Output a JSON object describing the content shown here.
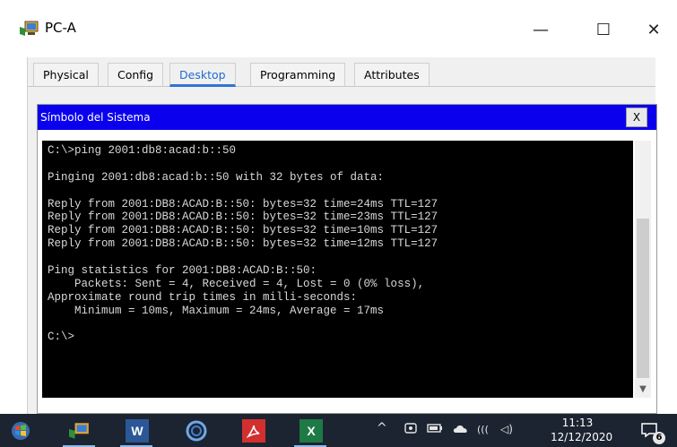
{
  "window": {
    "title": "PC-A",
    "icon": "packet-tracer-pc-icon",
    "controls": {
      "minimize": "—",
      "maximize": "☐",
      "close": "✕"
    }
  },
  "tabs": [
    {
      "label": "Physical",
      "active": false
    },
    {
      "label": "Config",
      "active": false
    },
    {
      "label": "Desktop",
      "active": true
    },
    {
      "label": "Programming",
      "active": false
    },
    {
      "label": "Attributes",
      "active": false
    }
  ],
  "command_prompt": {
    "title": "Símbolo del Sistema",
    "close_label": "X",
    "lines": [
      "C:\\>ping 2001:db8:acad:b::50",
      "",
      "Pinging 2001:db8:acad:b::50 with 32 bytes of data:",
      "",
      "Reply from 2001:DB8:ACAD:B::50: bytes=32 time=24ms TTL=127",
      "Reply from 2001:DB8:ACAD:B::50: bytes=32 time=23ms TTL=127",
      "Reply from 2001:DB8:ACAD:B::50: bytes=32 time=10ms TTL=127",
      "Reply from 2001:DB8:ACAD:B::50: bytes=32 time=12ms TTL=127",
      "",
      "Ping statistics for 2001:DB8:ACAD:B::50:",
      "    Packets: Sent = 4, Received = 4, Lost = 0 (0% loss),",
      "Approximate round trip times in milli-seconds:",
      "    Minimum = 10ms, Maximum = 24ms, Average = 17ms",
      "",
      "C:\\>"
    ]
  },
  "taskbar": {
    "apps": [
      {
        "name": "windows-start-icon"
      },
      {
        "name": "packet-tracer-icon"
      },
      {
        "name": "word-icon",
        "glyph": "W"
      },
      {
        "name": "cortana-icon"
      },
      {
        "name": "acrobat-icon"
      },
      {
        "name": "excel-icon",
        "glyph": "X"
      }
    ],
    "tray_symbols": {
      "chevron": "^",
      "wifi": "(((",
      "volume": "◁)"
    },
    "time": "11:13",
    "date": "12/12/2020",
    "notification_count": "6",
    "colors": {
      "background": "#1c2431",
      "word": "#2b5797",
      "excel": "#1d7a45",
      "acrobat": "#d32f2f"
    }
  }
}
